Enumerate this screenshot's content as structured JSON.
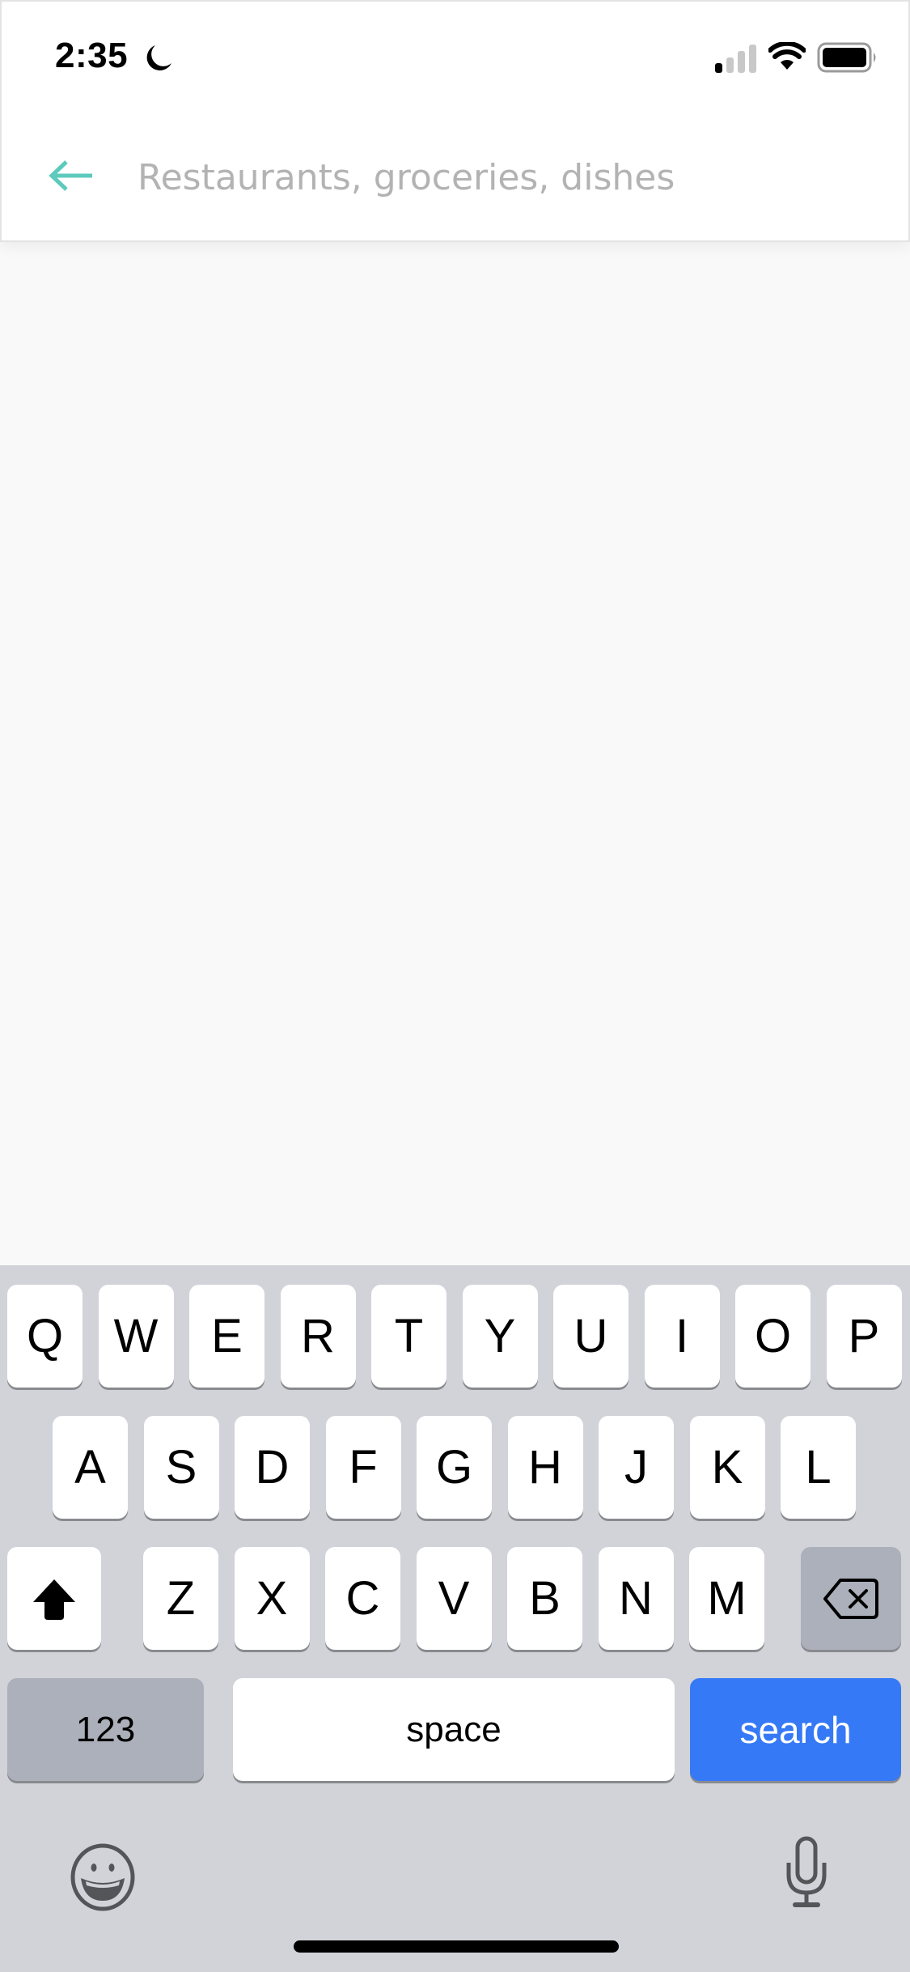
{
  "status_bar": {
    "time": "2:35",
    "focus_icon": "moon-icon",
    "signal_bars_active": 1,
    "signal_bars_total": 4,
    "wifi_icon": "wifi-icon",
    "battery_level": 1.0
  },
  "header": {
    "back_icon": "arrow-left-icon",
    "search": {
      "value": "",
      "placeholder": "Restaurants, groceries, dishes"
    }
  },
  "colors": {
    "accent": "#5ccabc",
    "placeholder": "#b3b3b3",
    "keyboard_bg": "#d1d3d9",
    "key_bg": "#ffffff",
    "special_key_bg": "#abb0ba",
    "search_key_bg": "#3579f6",
    "content_bg": "#f9f9f9"
  },
  "keyboard": {
    "row1": [
      "Q",
      "W",
      "E",
      "R",
      "T",
      "Y",
      "U",
      "I",
      "O",
      "P"
    ],
    "row2": [
      "A",
      "S",
      "D",
      "F",
      "G",
      "H",
      "J",
      "K",
      "L"
    ],
    "row3": [
      "Z",
      "X",
      "C",
      "V",
      "B",
      "N",
      "M"
    ],
    "shift_icon": "shift-icon",
    "delete_icon": "delete-icon",
    "numbers_label": "123",
    "space_label": "space",
    "search_label": "search",
    "emoji_icon": "emoji-icon",
    "mic_icon": "microphone-icon"
  }
}
